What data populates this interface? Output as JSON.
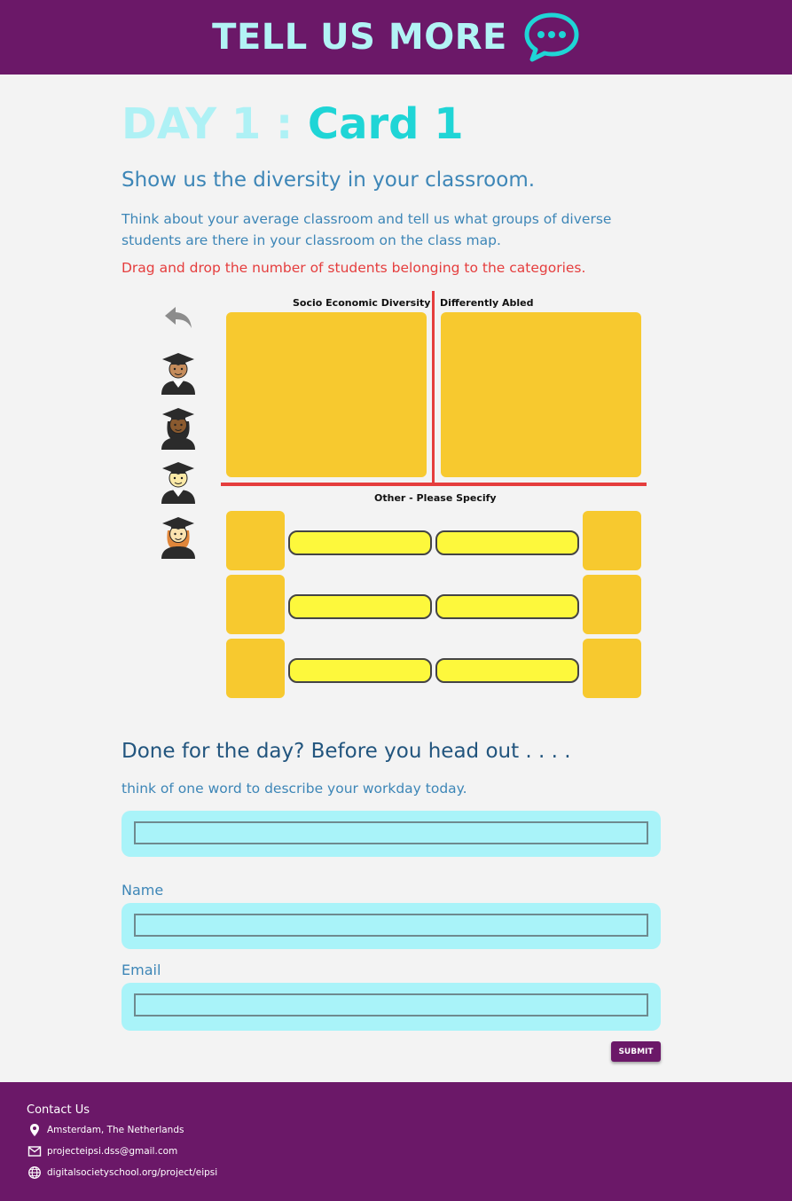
{
  "header": {
    "title": "TELL US MORE",
    "icon": "chat-bubble-icon"
  },
  "page": {
    "day_label": "DAY 1 :",
    "card_label": "Card 1",
    "subtitle": "Show us the diversity in your classroom.",
    "intro": "Think about your average classroom and tell us what groups of diverse students are there in your classroom on the class map.",
    "instruction": "Drag and drop the number of students belonging to the categories."
  },
  "tray": {
    "undo_icon": "undo-arrow-icon",
    "students": [
      "student-graduate-man-icon",
      "student-graduate-woman-icon",
      "student-graduate-boy-icon",
      "student-graduate-girl-icon"
    ]
  },
  "class_map": {
    "quadrant_left_label": "Socio Economic Diversity",
    "quadrant_right_label": "Differently Abled",
    "other_label": "Other - Please Specify",
    "other_inputs": [
      "",
      "",
      "",
      "",
      "",
      ""
    ]
  },
  "closing": {
    "heading": "Done for the day? Before you head out . . . .",
    "prompt": "think of one word to describe your workday today.",
    "word_value": "",
    "name_label": "Name",
    "name_value": "",
    "email_label": "Email",
    "email_value": "",
    "submit_label": "SUBMIT"
  },
  "footer": {
    "title": "Contact Us",
    "location": "Amsterdam, The Netherlands",
    "email": "projecteipsi.dss@gmail.com",
    "website": "digitalsocietyschool.org/project/eipsi"
  },
  "colors": {
    "brand_purple": "#6b1868",
    "cyan_light": "#aef1f5",
    "cyan": "#1fd5d6",
    "text_blue": "#3d86b7",
    "accent_red": "#e53d3d",
    "map_yellow": "#f7c92f",
    "input_yellow": "#fdf83c",
    "field_cyan": "#a9f3f9"
  }
}
